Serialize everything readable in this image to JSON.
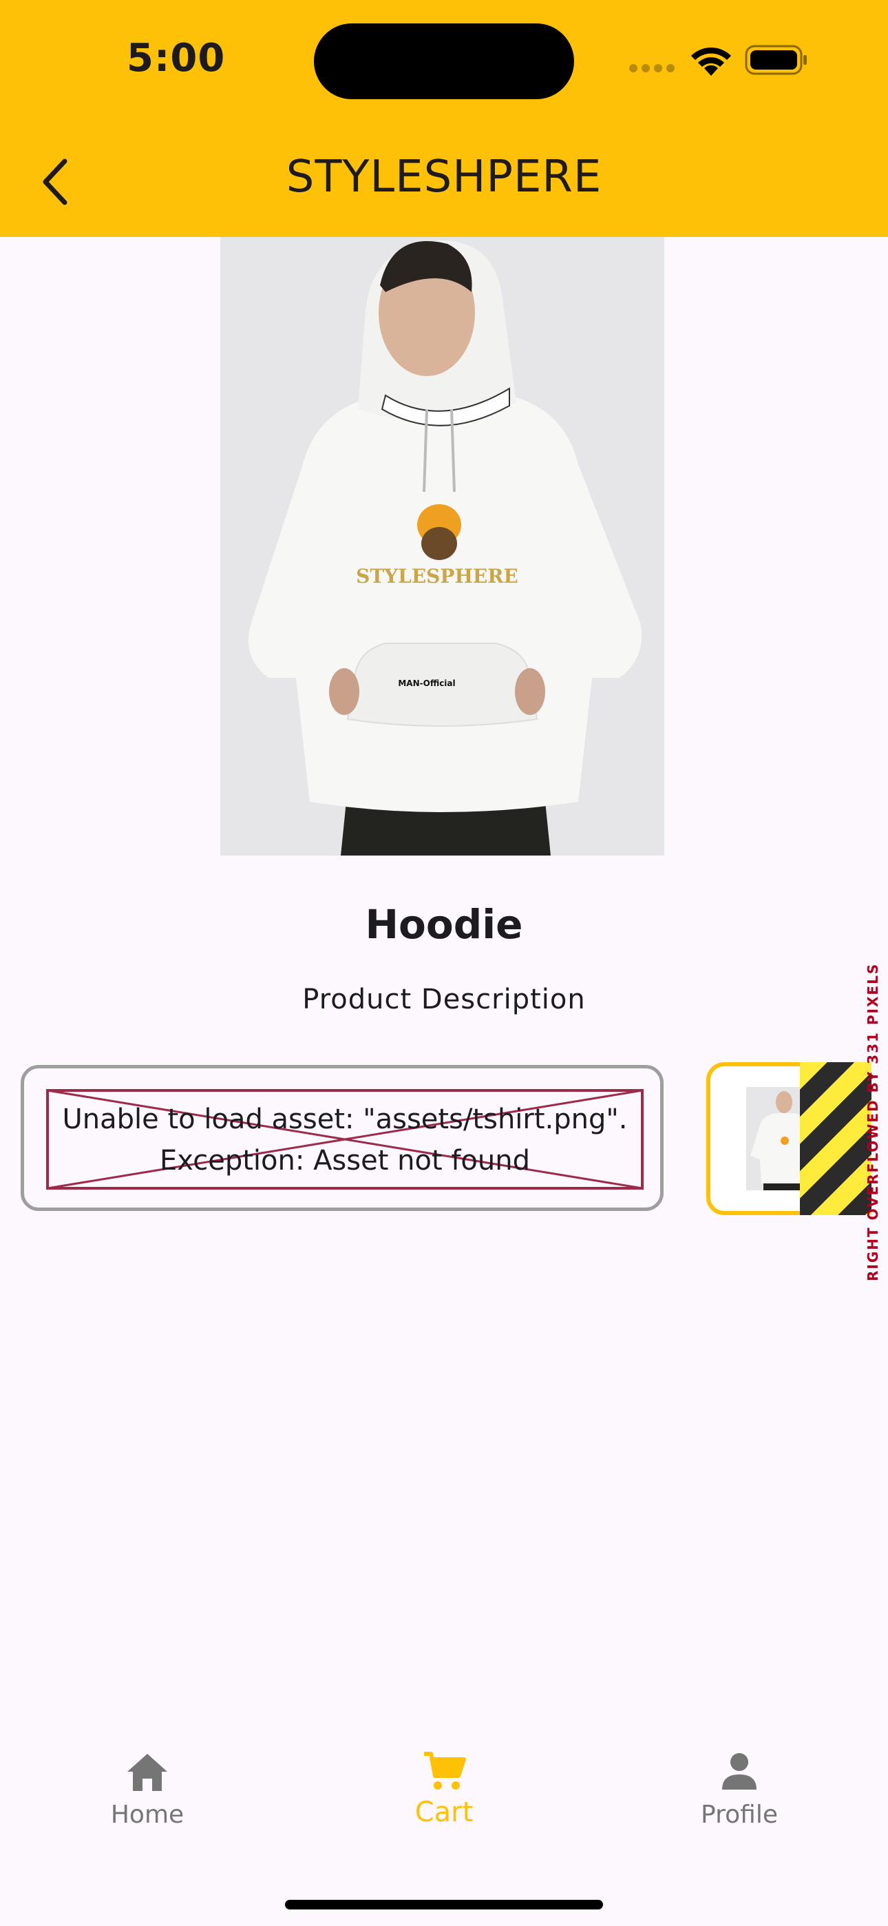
{
  "status_bar": {
    "time": "5:00"
  },
  "app_bar": {
    "title": "STYLESHPERE",
    "back_icon": "chevron-left-icon"
  },
  "product": {
    "name": "Hoodie",
    "description": "Product Description",
    "image_print_text": "STYLESPHERE",
    "tag_text": "MAN-Official"
  },
  "asset_error": {
    "line1": "Unable to load asset: \"assets/tshirt.png\".",
    "line2": "Exception: Asset not found"
  },
  "overflow_warning": "RIGHT OVERFLOWED BY 331 PIXELS",
  "bottom_nav": {
    "items": [
      {
        "label": "Home",
        "icon": "home-icon",
        "active": false
      },
      {
        "label": "Cart",
        "icon": "cart-icon",
        "active": true
      },
      {
        "label": "Profile",
        "icon": "person-icon",
        "active": false
      }
    ]
  },
  "colors": {
    "accent": "#ffc107",
    "background": "#fdf7fe",
    "inactive": "#757575",
    "error": "#9e2a4a"
  }
}
